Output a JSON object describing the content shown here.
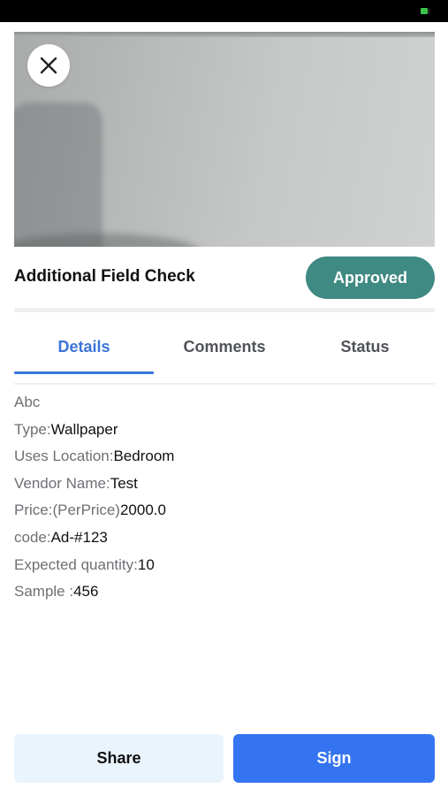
{
  "header": {
    "title": "Additional Field Check",
    "status": "Approved"
  },
  "tabs": [
    {
      "label": "Details",
      "active": true
    },
    {
      "label": "Comments",
      "active": false
    },
    {
      "label": "Status",
      "active": false
    }
  ],
  "details": {
    "heading": "Abc",
    "rows": [
      {
        "label": "Type:",
        "value": "Wallpaper"
      },
      {
        "label": "Uses Location:",
        "value": "Bedroom"
      },
      {
        "label": "Vendor Name:",
        "value": "Test"
      },
      {
        "label": "Price:(PerPrice)",
        "value": "2000.0"
      },
      {
        "label": "code:",
        "value": "Ad-#123"
      },
      {
        "label": "Expected quantity:",
        "value": "10"
      },
      {
        "label": "Sample :",
        "value": "456"
      }
    ]
  },
  "actions": {
    "share_label": "Share",
    "sign_label": "Sign"
  },
  "icons": {
    "close": "close-icon",
    "battery": "battery-icon"
  },
  "colors": {
    "accent": "#3b74d9",
    "status_badge": "#3f8a83",
    "sign_button": "#3474f0",
    "share_button": "#eaf4fd"
  }
}
